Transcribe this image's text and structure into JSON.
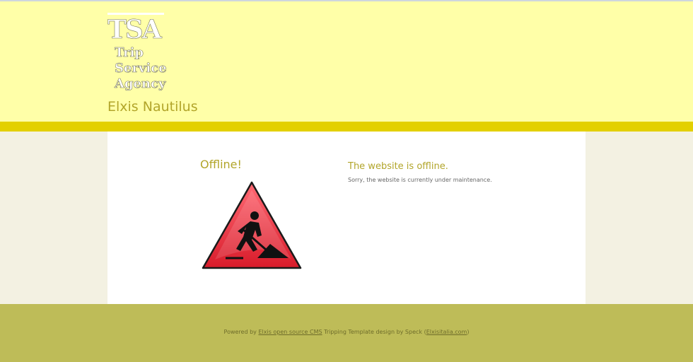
{
  "header": {
    "logo_text": "TSA",
    "logo_lines": [
      "Trip",
      "Service",
      "Agency"
    ],
    "site_name": "Elxis Nautilus"
  },
  "main": {
    "offline_title": "Offline!",
    "message_title": "The website is offline.",
    "message_text": "Sorry, the website is currently under maintenance."
  },
  "footer": {
    "powered_by": "Powered by",
    "cms_link": "Elxis open source CMS",
    "template_text": "Tripping Template design by Speck (",
    "site_link": "Elxisitalia.com",
    "close_paren": ")"
  },
  "colors": {
    "header_bg": "#ffffa8",
    "band": "#e3d000",
    "footer_bg": "#bebc58",
    "accent_text": "#b2a52a",
    "sign_red": "#e8313d"
  },
  "icons": {
    "logo": "tsa-logo",
    "sign": "men-at-work-warning-sign-icon"
  }
}
